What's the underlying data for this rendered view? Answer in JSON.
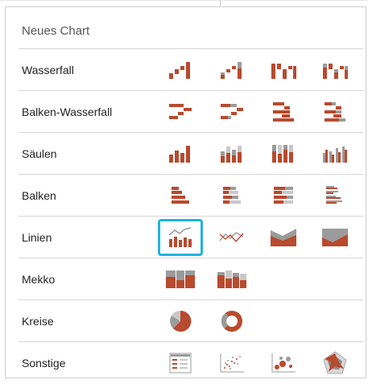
{
  "header": {
    "title": "Neues Chart"
  },
  "colors": {
    "accent_red": "#b84a2e",
    "gray": "#9b9b9b",
    "light_gray": "#c8c8c8",
    "selection": "#20b4e0"
  },
  "rows": [
    {
      "label": "Wasserfall",
      "icons": [
        "waterfall-icon",
        "waterfall-stacked-icon",
        "waterfall-bridge-icon",
        "waterfall-bridge-stacked-icon"
      ]
    },
    {
      "label": "Balken-Wasserfall",
      "icons": [
        "horizontal-waterfall-icon",
        "horizontal-waterfall-stacked-icon",
        "horizontal-waterfall-bridge-icon",
        "horizontal-waterfall-bridge-stacked-icon"
      ]
    },
    {
      "label": "Säulen",
      "icons": [
        "column-chart-icon",
        "stacked-column-icon",
        "stacked-column-100-icon",
        "clustered-column-icon"
      ]
    },
    {
      "label": "Balken",
      "icons": [
        "bar-chart-icon",
        "stacked-bar-icon",
        "stacked-bar-100-icon",
        "clustered-bar-icon"
      ]
    },
    {
      "label": "Linien",
      "icons": [
        "line-column-combo-icon",
        "line-chart-icon",
        "area-chart-icon",
        "area-chart-100-icon"
      ],
      "selected": 0
    },
    {
      "label": "Mekko",
      "icons": [
        "mekko-icon",
        "mekko-stacked-icon"
      ]
    },
    {
      "label": "Kreise",
      "icons": [
        "pie-chart-icon",
        "doughnut-chart-icon"
      ]
    },
    {
      "label": "Sonstige",
      "icons": [
        "table-chart-icon",
        "scatter-chart-icon",
        "bubble-chart-icon",
        "radar-chart-icon"
      ]
    }
  ]
}
